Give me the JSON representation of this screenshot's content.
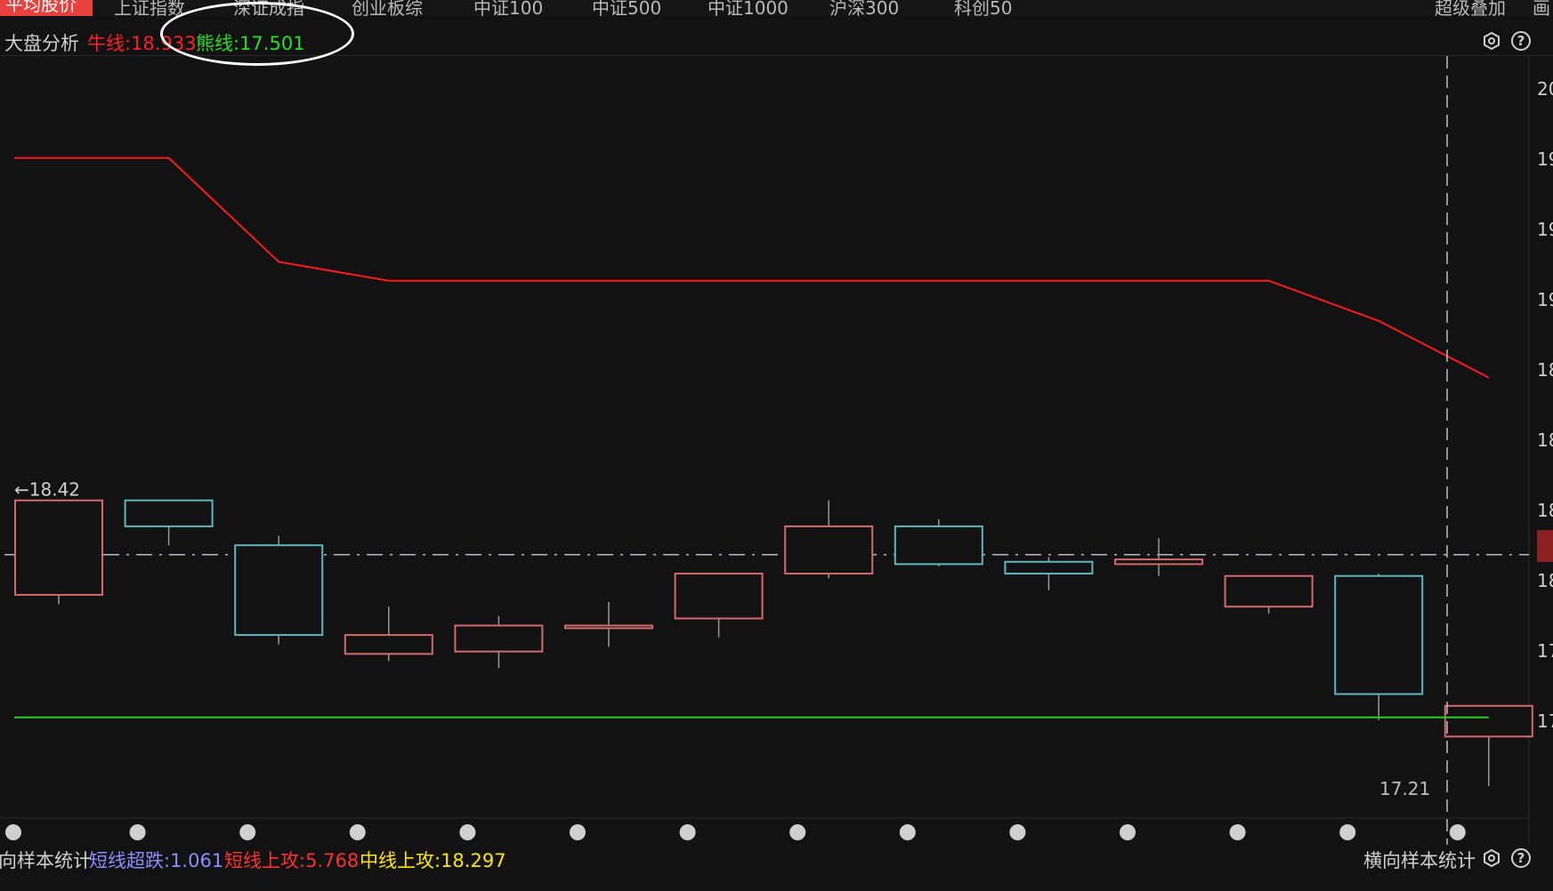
{
  "tabs": [
    {
      "label": "平均股价",
      "active": true
    },
    {
      "label": "上证指数"
    },
    {
      "label": "深证成指"
    },
    {
      "label": "创业板综"
    },
    {
      "label": "中证100"
    },
    {
      "label": "中证500"
    },
    {
      "label": "中证1000"
    },
    {
      "label": "沪深300"
    },
    {
      "label": "科创50"
    }
  ],
  "tabs_right": {
    "overlay": "超级叠加",
    "draw": "画"
  },
  "infobar": {
    "title": "大盘分析",
    "bull_label": "牛线:18.933",
    "bear_label": "熊线:17.501"
  },
  "bottombar": {
    "left_title": "向样本统计",
    "short_oversold": "短线超跌:1.061",
    "short_attack": "短线上攻:5.768",
    "mid_attack": "中线上攻:18.297",
    "right_title": "横向样本统计"
  },
  "colors": {
    "up": "#d46a6a",
    "down": "#5fb6be",
    "bull_line": "#ff1a1a",
    "bear_line": "#1fd51f",
    "blue_text": "#8c8cff",
    "red_text": "#ff3030",
    "yellow_text": "#ffe600",
    "green_text": "#25e025"
  },
  "chart_data": {
    "type": "candlestick",
    "ylim": [
      17.15,
      20.2
    ],
    "y_ticks": [
      "20",
      "19",
      "19",
      "19",
      "18",
      "18",
      "18",
      "18",
      "17",
      "17"
    ],
    "candles": [
      {
        "open": 18.02,
        "high": 18.42,
        "low": 17.98,
        "close": 18.42
      },
      {
        "open": 18.42,
        "high": 18.42,
        "low": 18.23,
        "close": 18.31
      },
      {
        "open": 18.23,
        "high": 18.27,
        "low": 17.81,
        "close": 17.85
      },
      {
        "open": 17.77,
        "high": 17.97,
        "low": 17.74,
        "close": 17.85
      },
      {
        "open": 17.78,
        "high": 17.93,
        "low": 17.71,
        "close": 17.89
      },
      {
        "open": 17.88,
        "high": 17.99,
        "low": 17.8,
        "close": 17.89
      },
      {
        "open": 17.92,
        "high": 18.1,
        "low": 17.84,
        "close": 18.11
      },
      {
        "open": 18.11,
        "high": 18.42,
        "low": 18.09,
        "close": 18.31
      },
      {
        "open": 18.31,
        "high": 18.34,
        "low": 18.14,
        "close": 18.15
      },
      {
        "open": 18.16,
        "high": 18.18,
        "low": 18.04,
        "close": 18.11
      },
      {
        "open": 18.15,
        "high": 18.26,
        "low": 18.1,
        "close": 18.17
      },
      {
        "open": 17.97,
        "high": 18.1,
        "low": 17.94,
        "close": 18.1
      },
      {
        "open": 18.1,
        "high": 18.11,
        "low": 17.49,
        "close": 17.6
      },
      {
        "open": 17.42,
        "high": 17.55,
        "low": 17.21,
        "close": 17.55
      }
    ],
    "bull_line": [
      19.87,
      19.87,
      19.43,
      19.35,
      19.35,
      19.35,
      19.35,
      19.35,
      19.35,
      19.35,
      19.35,
      19.35,
      19.18,
      18.94
    ],
    "bear_line": 17.501,
    "dash_line": 18.19,
    "max_label": "←18.42",
    "min_label": "17.21"
  }
}
